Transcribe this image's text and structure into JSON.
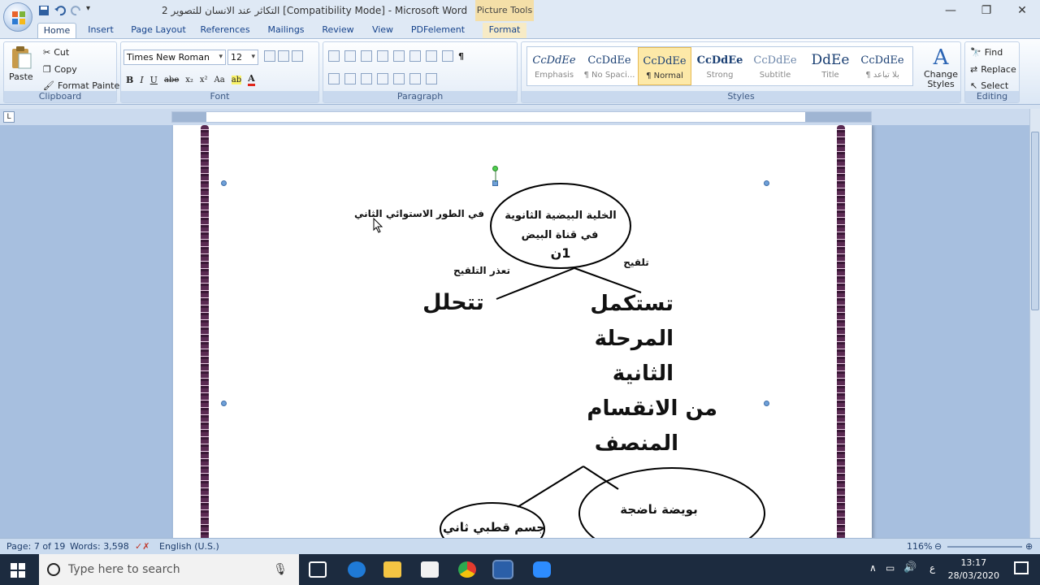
{
  "window": {
    "title": "التكاثر عند الانسان للتصوير 2 [Compatibility Mode] - Microsoft Word",
    "context_tab_title": "Picture Tools",
    "controls": [
      "—",
      "❐",
      "✕"
    ]
  },
  "tabs": [
    "Home",
    "Insert",
    "Page Layout",
    "References",
    "Mailings",
    "Review",
    "View",
    "PDFelement",
    "Format"
  ],
  "ribbon": {
    "clipboard": {
      "label": "Clipboard",
      "paste": "Paste",
      "cut": "Cut",
      "copy": "Copy",
      "format_painter": "Format Painter"
    },
    "font": {
      "label": "Font",
      "family": "Times New Roman",
      "size": "12"
    },
    "paragraph": {
      "label": "Paragraph"
    },
    "styles": {
      "label": "Styles",
      "items": [
        {
          "sample": "CcDdEe",
          "name": "Emphasis"
        },
        {
          "sample": "CcDdEe",
          "name": "¶ No Spaci..."
        },
        {
          "sample": "CcDdEe",
          "name": "¶ Normal"
        },
        {
          "sample": "CcDdEe",
          "name": "Strong"
        },
        {
          "sample": "CcDdEe",
          "name": "Subtitle"
        },
        {
          "sample": "DdEe",
          "name": "Title"
        },
        {
          "sample": "CcDdEe",
          "name": "¶ بلا تباعد"
        }
      ],
      "change_styles": "Change Styles"
    },
    "editing": {
      "label": "Editing",
      "find": "Find",
      "replace": "Replace",
      "select": "Select"
    }
  },
  "diagram": {
    "top_circle_line1": "الخلية البيضية الثانوية",
    "top_circle_line2": "في قناة البيض",
    "top_circle_line3": "1ن",
    "left_note": "في الطور الاستوائي الثاني",
    "branch_left_label": "تعذر التلقيح",
    "branch_right_label": "تلقيح",
    "left_result": "تتحلل",
    "right_result_1": "تستكمل",
    "right_result_2": "المرحلة",
    "right_result_3": "الثانية",
    "right_result_4": "من الانقسام",
    "right_result_5": "المنصف",
    "bottom_right_circle": "بويضة ناضجة",
    "bottom_left_circle": "جسم قطبي ثاني"
  },
  "statusbar": {
    "page": "Page: 7 of 19",
    "words": "Words: 3,598",
    "language": "English (U.S.)",
    "zoom": "116%"
  },
  "taskbar": {
    "search_placeholder": "Type here to search",
    "time": "13:17",
    "date": "28/03/2020",
    "lang": "ع"
  }
}
